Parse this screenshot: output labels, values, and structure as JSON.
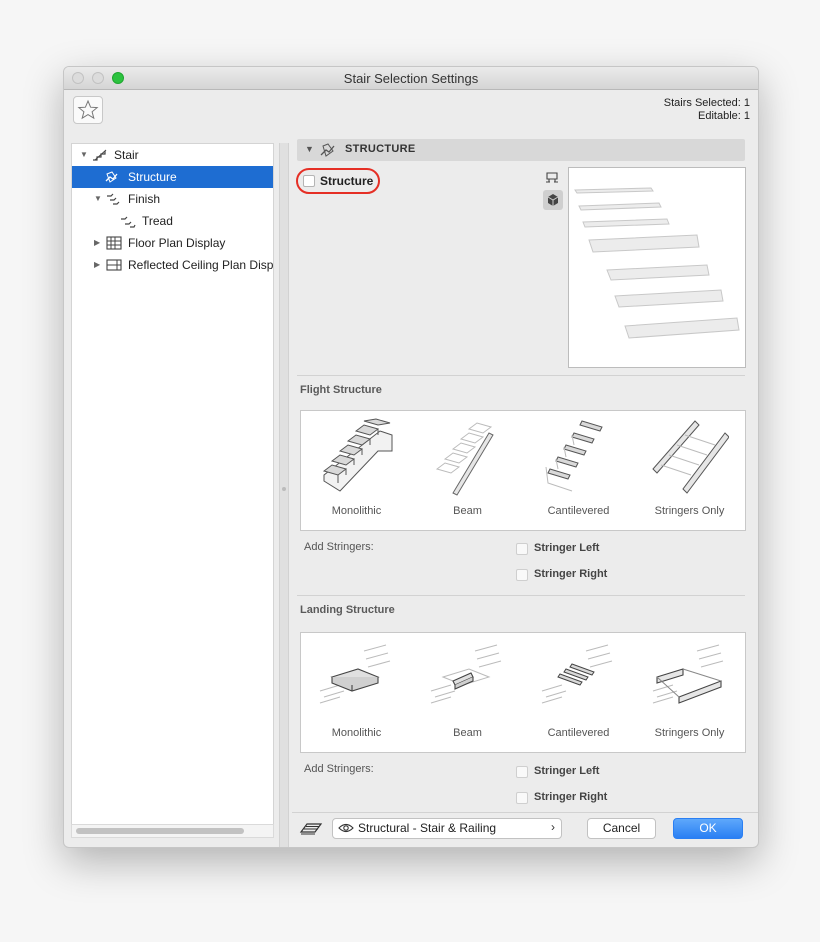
{
  "window": {
    "title": "Stair Selection Settings"
  },
  "header": {
    "selected_text": "Stairs Selected: 1",
    "editable_text": "Editable: 1",
    "favorite_icon": "star-icon"
  },
  "tree": {
    "items": [
      {
        "label": "Stair",
        "level": 0,
        "expanded": true,
        "icon": "stair-icon"
      },
      {
        "label": "Structure",
        "level": 1,
        "selected": true,
        "icon": "structure-icon"
      },
      {
        "label": "Finish",
        "level": 1,
        "expanded": true,
        "icon": "finish-icon"
      },
      {
        "label": "Tread",
        "level": 2,
        "icon": "tread-icon"
      },
      {
        "label": "Floor Plan Display",
        "level": 1,
        "expanded": false,
        "icon": "floor-plan-icon"
      },
      {
        "label": "Reflected Ceiling Plan Displ",
        "level": 1,
        "expanded": false,
        "icon": "ceiling-plan-icon"
      }
    ]
  },
  "section": {
    "title": "STRUCTURE",
    "toggle_label": "Structure",
    "toggle_checked": false
  },
  "flight": {
    "title": "Flight Structure",
    "options": [
      "Monolithic",
      "Beam",
      "Cantilevered",
      "Stringers Only"
    ],
    "selected": "Monolithic",
    "add_stringers_label": "Add Stringers:",
    "stringer_left": "Stringer Left",
    "stringer_right": "Stringer Right"
  },
  "landing": {
    "title": "Landing Structure",
    "options": [
      "Monolithic",
      "Beam",
      "Cantilevered",
      "Stringers Only"
    ],
    "selected": "Monolithic",
    "add_stringers_label": "Add Stringers:",
    "stringer_left": "Stringer Left",
    "stringer_right": "Stringer Right"
  },
  "footer": {
    "view_label": "Structural - Stair & Railing",
    "cancel_label": "Cancel",
    "ok_label": "OK"
  },
  "colors": {
    "accent": "#1e6dd2",
    "highlight_ring": "#e52f25",
    "ok_button": "#2a7ff3"
  }
}
